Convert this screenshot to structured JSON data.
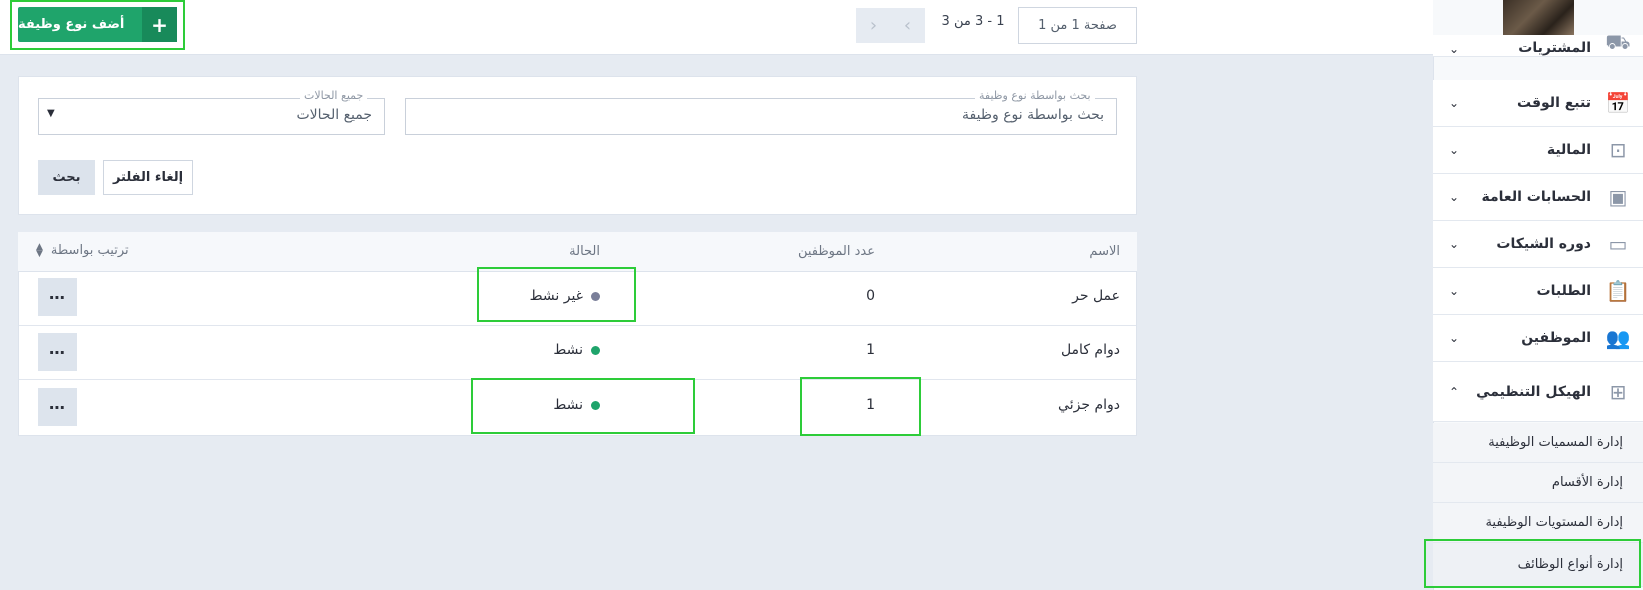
{
  "toolbar": {
    "add_label": "أضف نوع وظيفة",
    "add_icon": "+",
    "page_info": "صفحة 1 من 1",
    "range_info": "1 - 3 من 3",
    "prev_icon": "‹",
    "next_icon": "›"
  },
  "filters": {
    "search_legend": "بحث بواسطة نوع وظيفة",
    "search_placeholder": "بحث بواسطة نوع وظيفة",
    "status_legend": "جميع الحالات",
    "status_value": "جميع الحالات",
    "clear_label": "إلغاء الفلتر",
    "search_label": "بحث"
  },
  "table": {
    "headers": {
      "name": "الاسم",
      "employees": "عدد الموظفين",
      "status": "الحالة",
      "sort": "ترتيب بواسطة"
    },
    "rows": [
      {
        "name": "عمل حر",
        "employees": "0",
        "status": "غير نشط",
        "status_color": "#7a7f99",
        "more": "⋯"
      },
      {
        "name": "دوام كامل",
        "employees": "1",
        "status": "نشط",
        "status_color": "#1fa46b",
        "more": "⋯"
      },
      {
        "name": "دوام جزئي",
        "employees": "1",
        "status": "نشط",
        "status_color": "#1fa46b",
        "more": "⋯"
      }
    ]
  },
  "sidebar": {
    "items": [
      {
        "label": "المشتريات",
        "icon": "truck-icon"
      },
      {
        "label": "تتبع الوقت",
        "icon": "calendar-clock-icon"
      },
      {
        "label": "المالية",
        "icon": "safe-icon"
      },
      {
        "label": "الحسابات العامة",
        "icon": "money-icon"
      },
      {
        "label": "دوره الشيكات",
        "icon": "check-icon"
      },
      {
        "label": "الطلبات",
        "icon": "clipboard-icon"
      },
      {
        "label": "الموظفين",
        "icon": "users-icon"
      },
      {
        "label": "الهيكل التنظيمي",
        "icon": "org-chart-icon"
      }
    ],
    "sub_items": [
      "إدارة المسميات الوظيفية",
      "إدارة الأقسام",
      "إدارة المستويات الوظيفية",
      "إدارة أنواع الوظائف"
    ]
  },
  "colors": {
    "accent": "#1fa46b",
    "highlight": "#2dcc39"
  }
}
